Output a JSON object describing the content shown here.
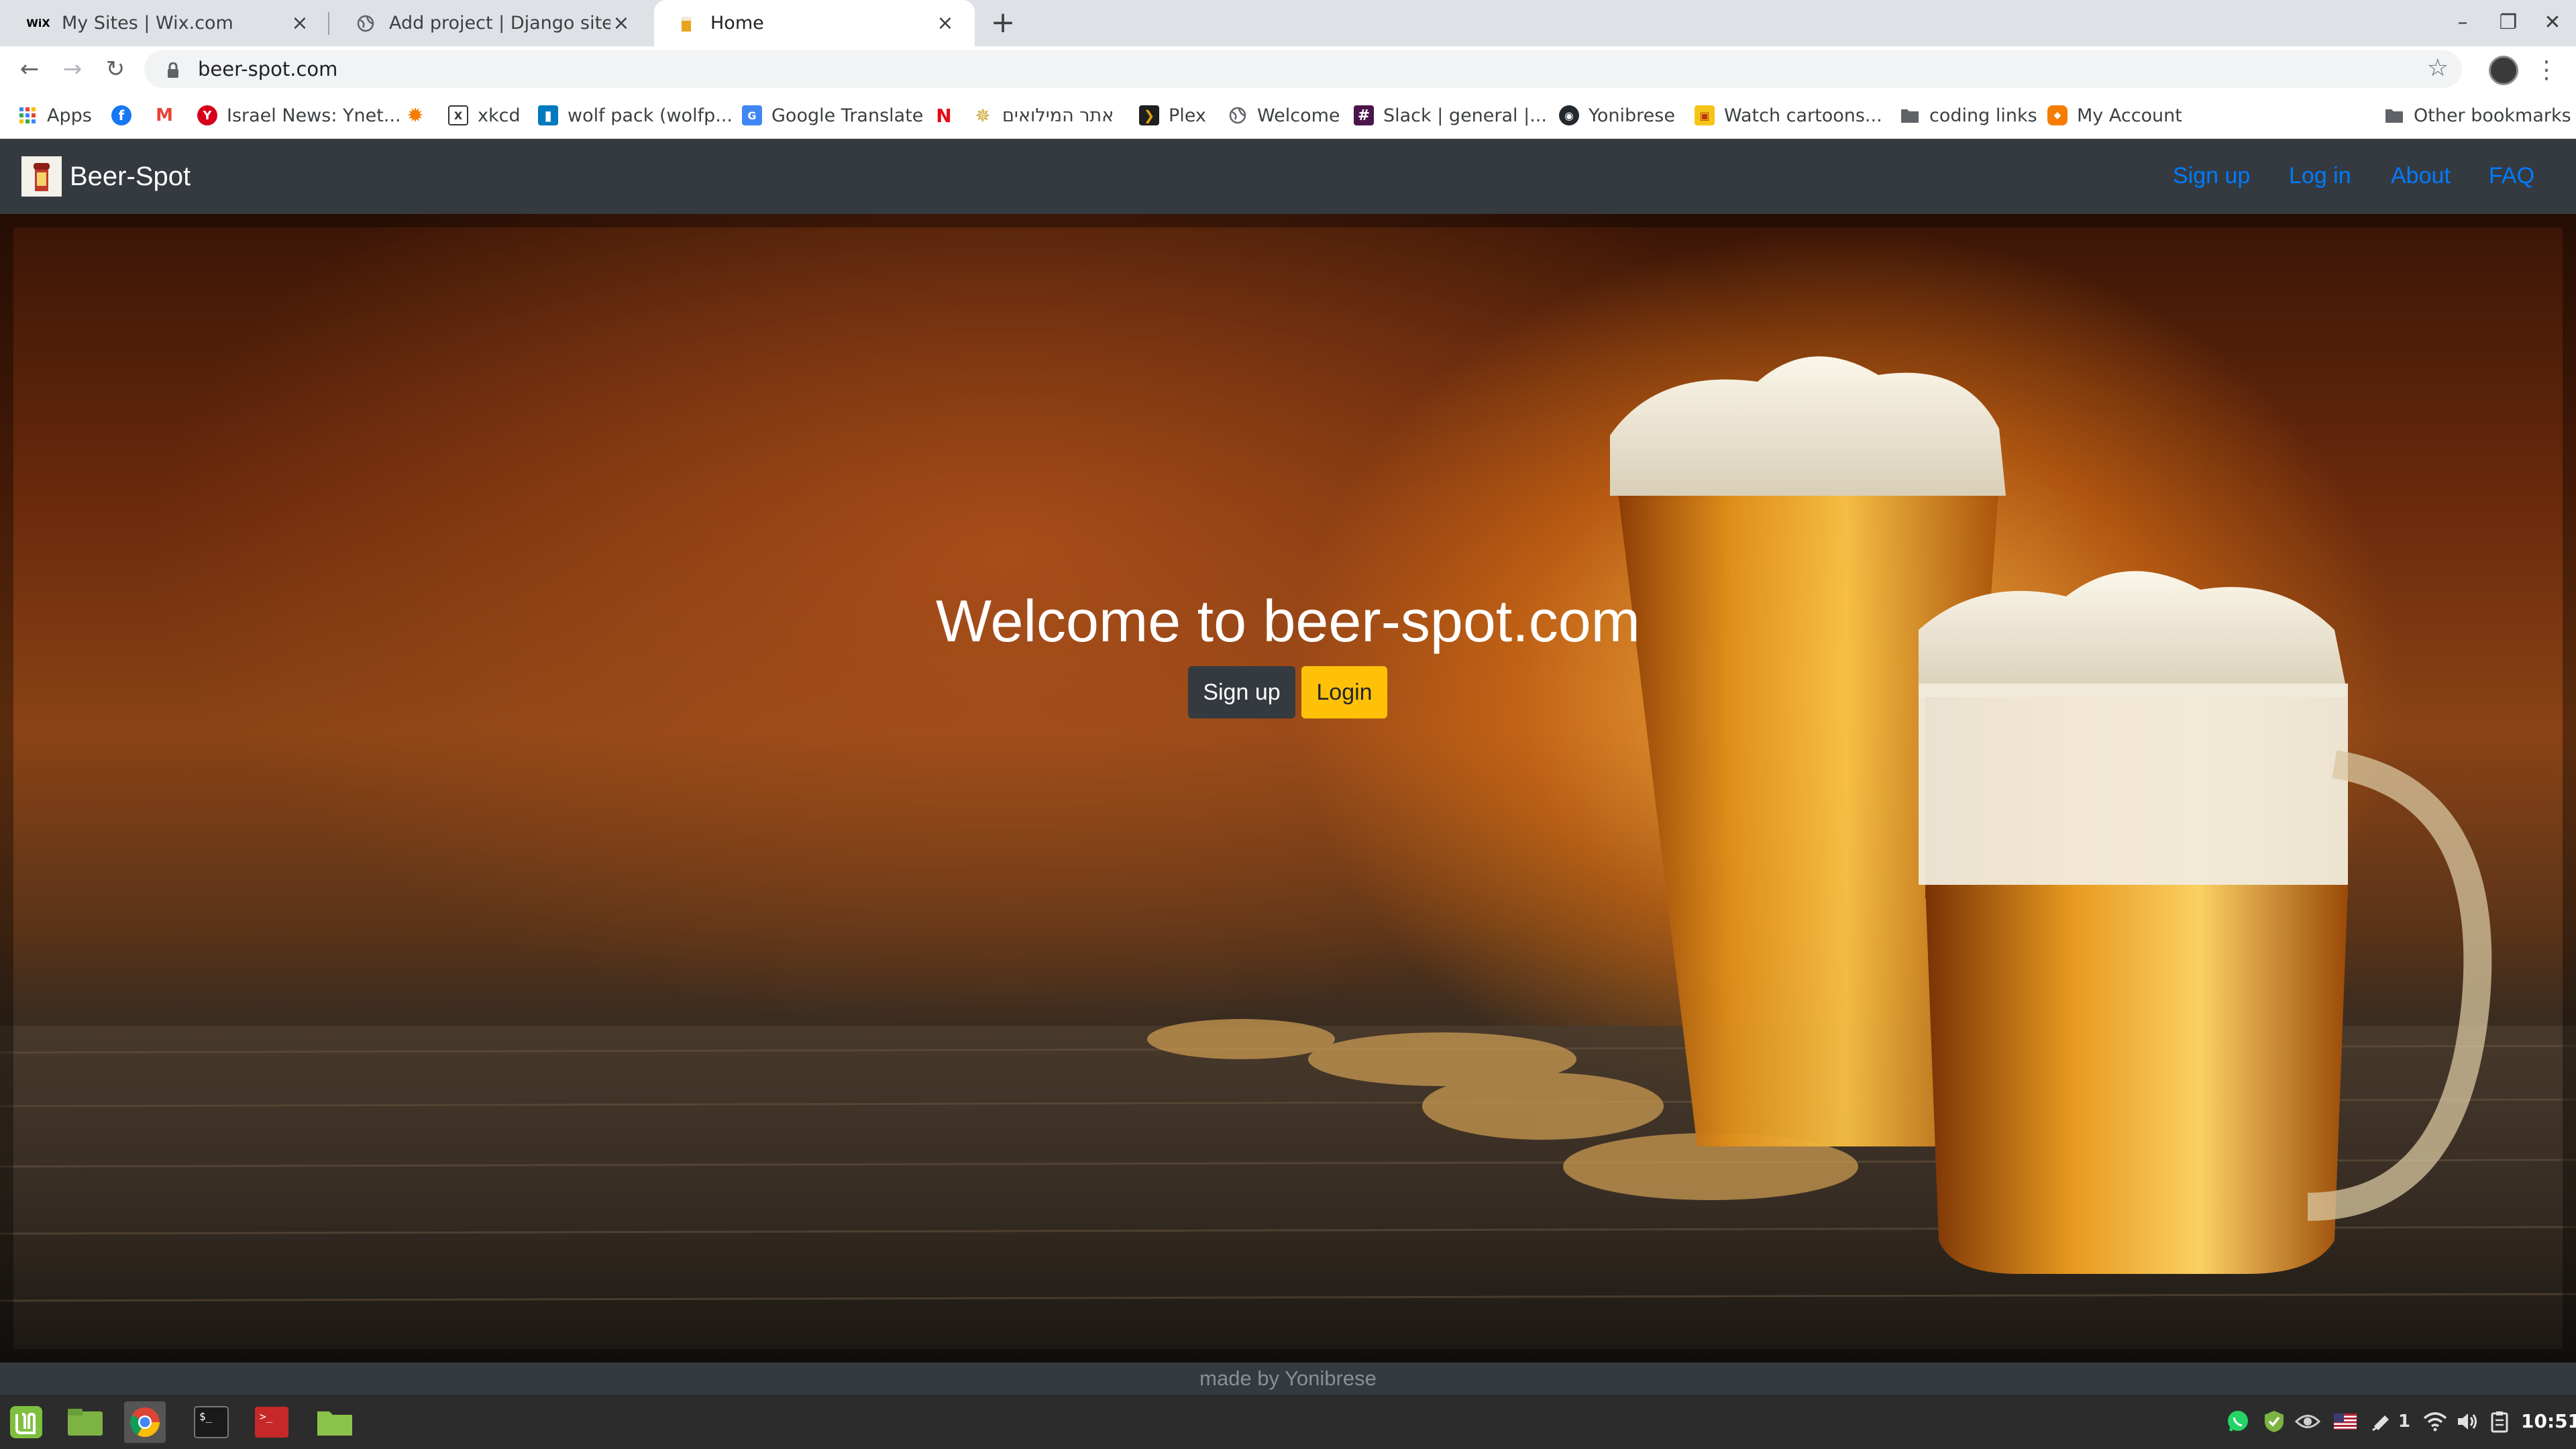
{
  "browser": {
    "tabs": [
      {
        "title": "My Sites | Wix.com",
        "favicon": "wix-icon"
      },
      {
        "title": "Add project | Django site admin",
        "favicon": "globe-icon"
      },
      {
        "title": "Home",
        "favicon": "beer-icon"
      }
    ],
    "url": "beer-spot.com"
  },
  "bookmarks": [
    {
      "label": "Apps",
      "icon": "apps-grid-icon"
    },
    {
      "label": "",
      "icon": "facebook-icon"
    },
    {
      "label": "",
      "icon": "gmail-icon"
    },
    {
      "label": "Israel News: Ynet...",
      "icon": "ynet-icon"
    },
    {
      "label": "",
      "icon": "sun-icon"
    },
    {
      "label": "xkcd",
      "icon": "xkcd-icon"
    },
    {
      "label": "wolf pack (wolfp...",
      "icon": "trello-icon"
    },
    {
      "label": "Google Translate",
      "icon": "google-translate-icon"
    },
    {
      "label": "",
      "icon": "netflix-icon"
    },
    {
      "label": "אתר המילואים",
      "icon": "badge-icon"
    },
    {
      "label": "Plex",
      "icon": "plex-icon"
    },
    {
      "label": "Welcome",
      "icon": "globe-icon"
    },
    {
      "label": "Slack | general |...",
      "icon": "slack-icon"
    },
    {
      "label": "Yonibrese",
      "icon": "github-icon"
    },
    {
      "label": "Watch cartoons...",
      "icon": "cartoon-icon"
    },
    {
      "label": "coding links",
      "icon": "folder-icon"
    },
    {
      "label": "My Account",
      "icon": "box-icon"
    },
    {
      "label": "Other bookmarks",
      "icon": "folder-icon"
    }
  ],
  "site": {
    "brand": "Beer-Spot",
    "nav": [
      "Sign up",
      "Log in",
      "About",
      "FAQ"
    ],
    "hero": {
      "heading": "Welcome to beer-spot.com",
      "signup_button": "Sign up",
      "login_button": "Login"
    },
    "footer": "made by Yonibrese"
  },
  "taskbar": {
    "clock": "10:51",
    "notification_count": "1"
  },
  "colors": {
    "navbar_bg": "#343a40",
    "nav_link": "#007bff",
    "login_button": "#ffc107",
    "signup_button": "#343a40"
  }
}
